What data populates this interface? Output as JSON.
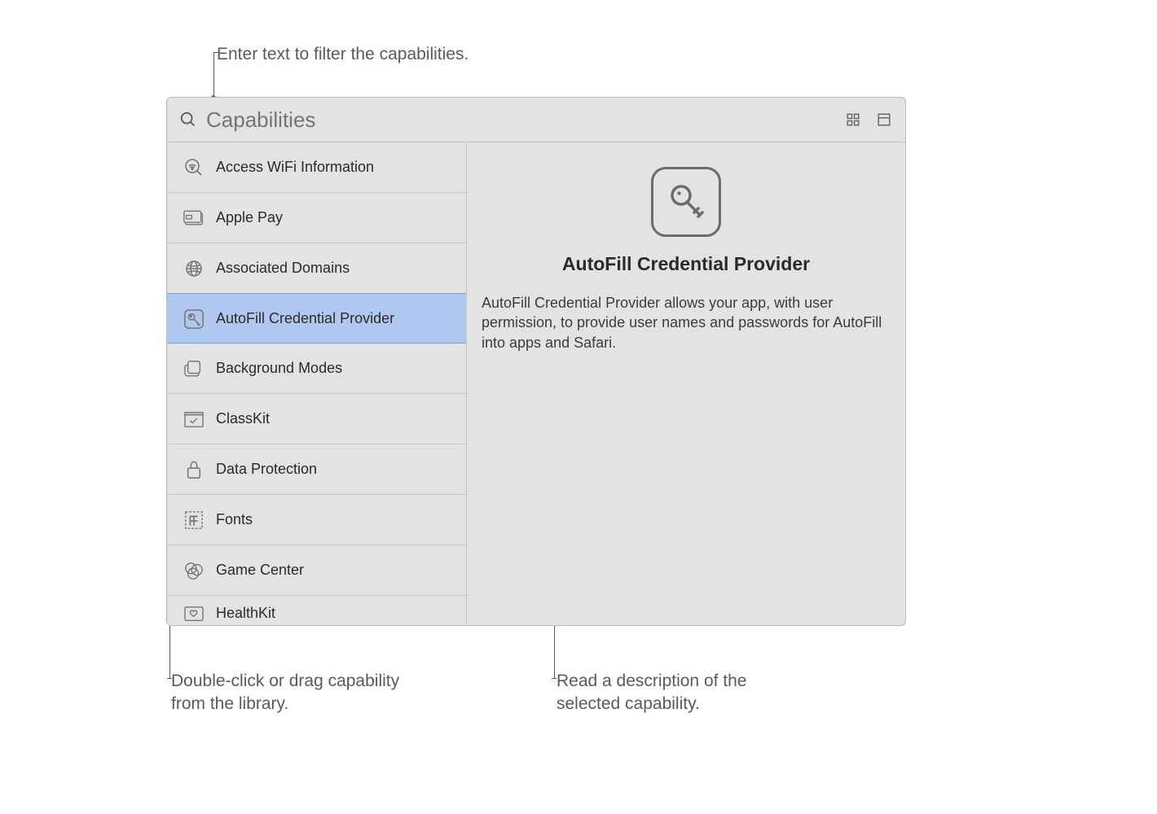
{
  "callouts": {
    "filter": "Enter text to filter the capabilities.",
    "library_line1": "Double-click or drag capability",
    "library_line2": "from the library.",
    "desc_line1": "Read a description of the",
    "desc_line2": "selected capability."
  },
  "search": {
    "placeholder": "Capabilities"
  },
  "list": {
    "items": [
      {
        "icon": "wifi-search",
        "label": "Access WiFi Information",
        "selected": false
      },
      {
        "icon": "applepay",
        "label": "Apple Pay",
        "selected": false
      },
      {
        "icon": "globe",
        "label": "Associated Domains",
        "selected": false
      },
      {
        "icon": "key-box",
        "label": "AutoFill Credential Provider",
        "selected": true
      },
      {
        "icon": "stack",
        "label": "Background Modes",
        "selected": false
      },
      {
        "icon": "classkit",
        "label": "ClassKit",
        "selected": false
      },
      {
        "icon": "lock",
        "label": "Data Protection",
        "selected": false
      },
      {
        "icon": "fonts",
        "label": "Fonts",
        "selected": false
      },
      {
        "icon": "gamecenter",
        "label": "Game Center",
        "selected": false
      },
      {
        "icon": "healthkit",
        "label": "HealthKit",
        "selected": false
      }
    ]
  },
  "detail": {
    "title": "AutoFill Credential Provider",
    "description": "AutoFill Credential Provider allows your app, with user permission, to provide user names and passwords for AutoFill into apps and Safari."
  }
}
